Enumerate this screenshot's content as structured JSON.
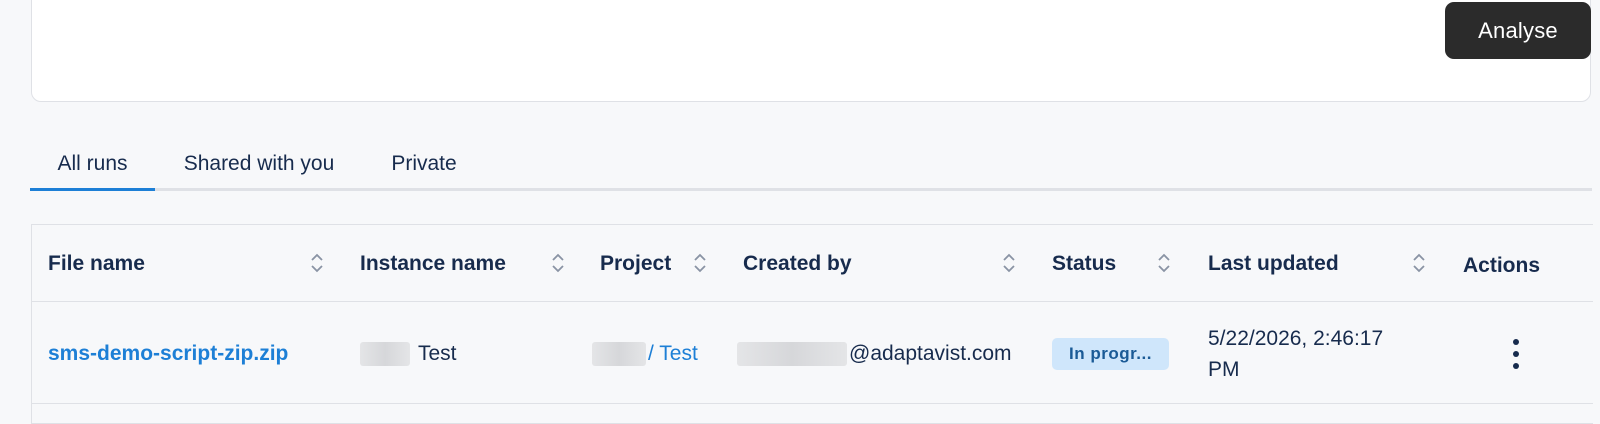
{
  "toolbar": {
    "analyse_label": "Analyse"
  },
  "tabs": [
    {
      "label": "All runs",
      "active": true
    },
    {
      "label": "Shared with you",
      "active": false
    },
    {
      "label": "Private",
      "active": false
    }
  ],
  "table": {
    "headers": {
      "file_name": "File name",
      "instance_name": "Instance name",
      "project": "Project",
      "created_by": "Created by",
      "status": "Status",
      "last_updated": "Last updated",
      "actions": "Actions"
    },
    "rows": [
      {
        "file_name": "sms-demo-script-zip.zip",
        "instance_name": "Test",
        "project": "/ Test",
        "created_by": "@adaptavist.com",
        "status": "In progr...",
        "last_updated_line1": "5/22/2026, 2:46:17",
        "last_updated_line2": "PM"
      }
    ]
  },
  "icons": {
    "sort": "sort-icon",
    "more": "more-vertical-icon"
  },
  "colors": {
    "accent": "#1d7fd6",
    "primary_button": "#2b2b2b",
    "status_badge_bg": "#cfe6fb",
    "status_badge_text": "#1a5a96"
  }
}
